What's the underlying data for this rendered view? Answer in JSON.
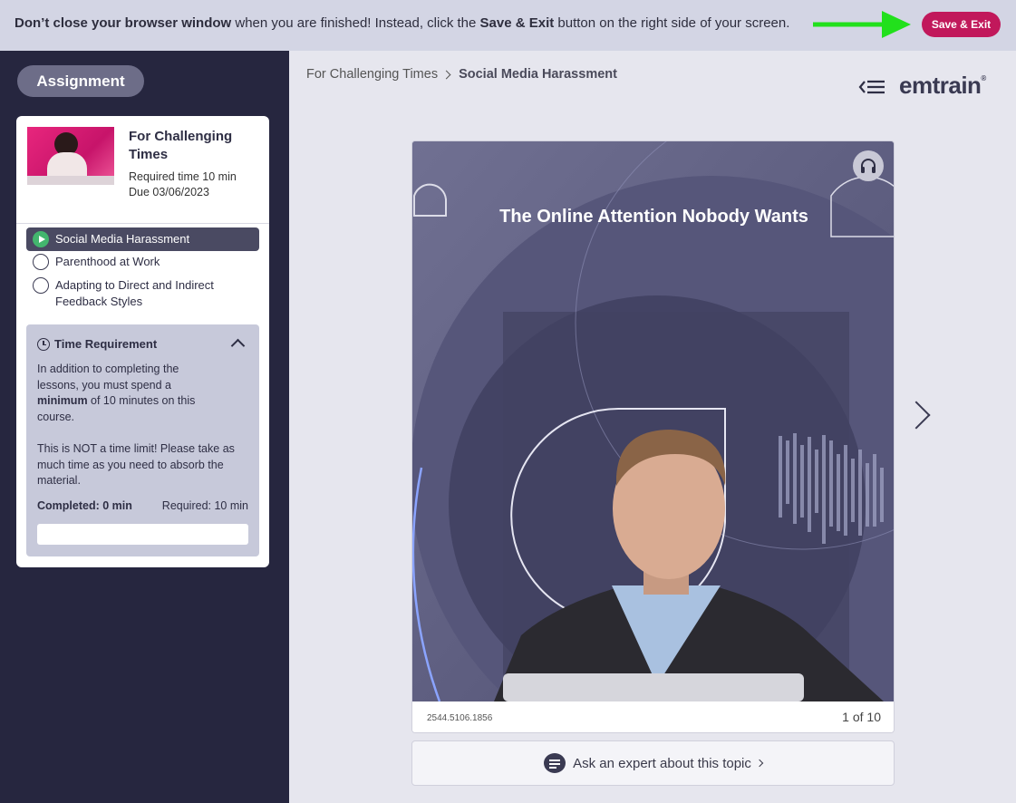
{
  "banner": {
    "bold_lead": "Don’t close your browser window",
    "text_mid": " when you are finished! Instead, click the ",
    "bold_button": "Save & Exit",
    "text_end": " button on the right side of your screen.",
    "save_label": "Save & Exit"
  },
  "sidebar": {
    "assignment_label": "Assignment",
    "course": {
      "title": "For Challenging Times",
      "required_time": "Required time 10 min",
      "due": "Due 03/06/2023"
    },
    "lessons": [
      {
        "label": "Social Media Harassment",
        "active": true
      },
      {
        "label": "Parenthood at Work",
        "active": false
      },
      {
        "label": "Adapting to Direct and Indirect Feedback Styles",
        "active": false
      }
    ],
    "time_requirement": {
      "heading": "Time Requirement",
      "p1_before": "In addition to completing the lessons, you must spend a ",
      "p1_bold": "minimum",
      "p1_after": " of 10 minutes on this course.",
      "p2": "This is NOT a time limit! Please take as much time as you need to absorb the material.",
      "completed": "Completed: 0 min",
      "required": "Required: 10 min",
      "progress_fraction": 0
    }
  },
  "main": {
    "breadcrumb": {
      "parent": "For Challenging Times",
      "current": "Social Media Harassment"
    },
    "logo": "emtrain",
    "logo_mark": "®",
    "slide": {
      "title": "The Online Attention Nobody Wants",
      "id": "2544.5106.1856",
      "counter": "1 of 10"
    },
    "ask_label": "Ask an expert about this topic"
  },
  "colors": {
    "accent": "#c1185b",
    "sidebar_bg": "#26263f",
    "active_green": "#43b66e",
    "arrow_green": "#22e01c"
  }
}
